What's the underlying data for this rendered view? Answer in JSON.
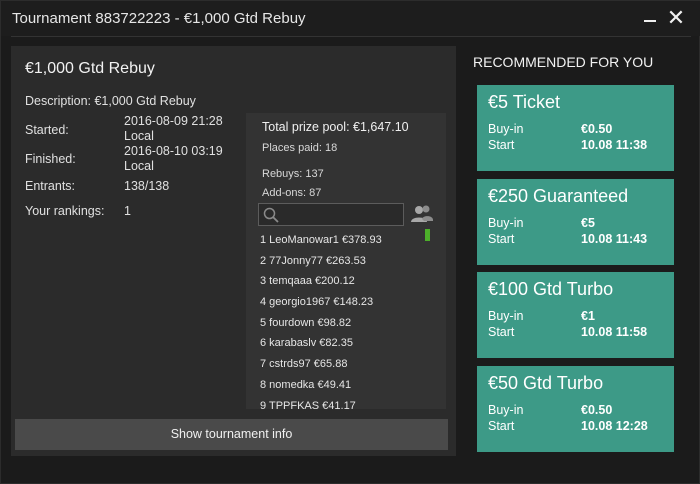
{
  "window": {
    "title": "Tournament 883722223 - €1,000 Gtd Rebuy",
    "minimize_icon": "minimize-icon",
    "close_icon": "close-icon",
    "close_glyph": "✕"
  },
  "tournament": {
    "name": "€1,000 Gtd Rebuy",
    "description": "Description: €1,000 Gtd Rebuy",
    "labels": {
      "started": "Started:",
      "finished": "Finished:",
      "entrants": "Entrants:",
      "rankings": "Your rankings:"
    },
    "started_date": "2016-08-09 21:28",
    "started_tz": "Local",
    "finished_date": "2016-08-10 03:19",
    "finished_tz": "Local",
    "entrants": "138/138",
    "rankings": "1"
  },
  "prize": {
    "total": "Total prize pool: €1,647.10",
    "places_paid": "Places paid: 18",
    "rebuys": "Rebuys: 137",
    "addons": "Add-ons: 87",
    "search_icon": "search-icon",
    "users_icon": "users-icon",
    "search_value": "",
    "players": [
      "1 LeoManowar1 €378.93",
      "2 77Jonny77 €263.53",
      "3 temqaaa €200.12",
      "4 georgio1967 €148.23",
      "5 fourdown €98.82",
      "6 karabaslv €82.35",
      "7 cstrds97 €65.88",
      "8 nomedka €49.41",
      "9 TPPFKAS €41.17"
    ]
  },
  "show_info_label": "Show tournament info",
  "recommended": {
    "title": "RECOMMENDED FOR YOU",
    "buyin_label": "Buy-in",
    "start_label": "Start",
    "cards": [
      {
        "name": "€5 Ticket",
        "buyin": "€0.50",
        "start": "10.08 11:38"
      },
      {
        "name": "€250 Guaranteed",
        "buyin": "€5",
        "start": "10.08 11:43"
      },
      {
        "name": "€100 Gtd Turbo",
        "buyin": "€1",
        "start": "10.08 11:58"
      },
      {
        "name": "€50 Gtd Turbo",
        "buyin": "€0.50",
        "start": "10.08 12:28"
      }
    ]
  },
  "colors": {
    "card_bg": "#3d9a87",
    "panel_bg": "#2b2b2b",
    "window_bg": "#1b1b1b",
    "scroll_indicator": "#4caf2a"
  }
}
